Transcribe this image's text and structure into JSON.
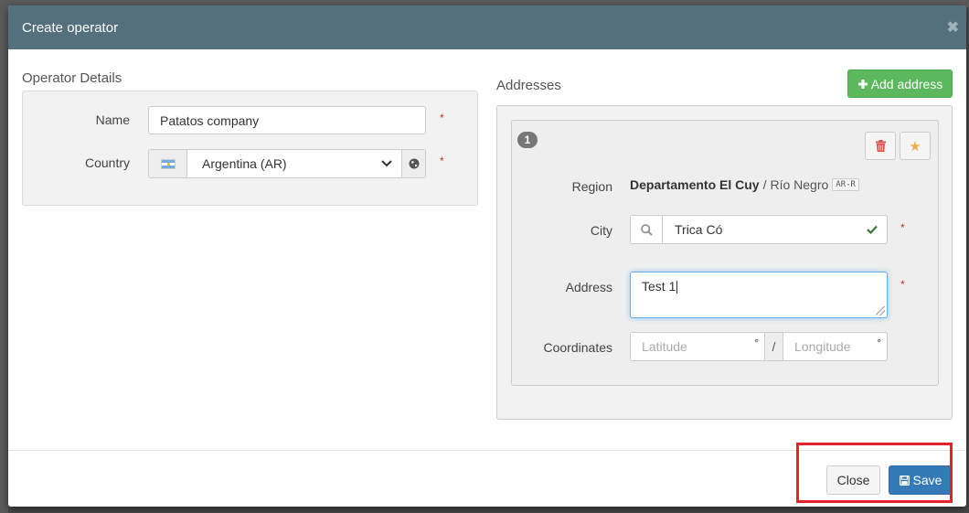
{
  "modal": {
    "title": "Create operator",
    "close_glyph": "✖"
  },
  "operator": {
    "section_title": "Operator Details",
    "name_label": "Name",
    "name_value": "Patatos company",
    "country_label": "Country",
    "country_value": "Argentina (AR)",
    "required_mark": "*"
  },
  "addresses": {
    "section_title": "Addresses",
    "add_button_label": "Add address",
    "items": [
      {
        "index": "1",
        "region_label": "Region",
        "region_primary": "Departamento El Cuy",
        "region_separator": "/",
        "region_secondary": "Río Negro",
        "region_code": "AR-R",
        "city_label": "City",
        "city_value": "Trica Có",
        "address_label": "Address",
        "address_value": "Test 1",
        "coordinates_label": "Coordinates",
        "latitude_placeholder": "Latitude",
        "longitude_placeholder": "Longitude",
        "degree_symbol": "°",
        "coord_separator": "/"
      }
    ]
  },
  "footer": {
    "close_label": "Close",
    "save_label": "Save"
  },
  "colors": {
    "header_bg": "#546f7d",
    "add_button": "#5cb85c",
    "save_button": "#337ab7",
    "required": "#c9302c",
    "highlight": "#e8202a",
    "star": "#f0ad4e"
  }
}
